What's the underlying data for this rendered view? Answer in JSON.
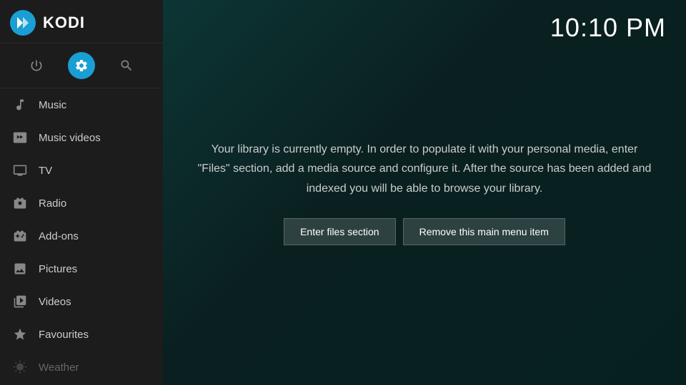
{
  "sidebar": {
    "logo_text": "KODI",
    "top_icons": [
      {
        "name": "power-icon",
        "symbol": "⏻",
        "active": false
      },
      {
        "name": "settings-icon",
        "symbol": "⚙",
        "active": true
      },
      {
        "name": "search-icon",
        "symbol": "🔍",
        "active": false
      }
    ],
    "nav_items": [
      {
        "id": "music",
        "label": "Music",
        "icon_name": "music-icon",
        "dimmed": false
      },
      {
        "id": "music-videos",
        "label": "Music videos",
        "icon_name": "music-video-icon",
        "dimmed": false
      },
      {
        "id": "tv",
        "label": "TV",
        "icon_name": "tv-icon",
        "dimmed": false
      },
      {
        "id": "radio",
        "label": "Radio",
        "icon_name": "radio-icon",
        "dimmed": false
      },
      {
        "id": "add-ons",
        "label": "Add-ons",
        "icon_name": "addons-icon",
        "dimmed": false
      },
      {
        "id": "pictures",
        "label": "Pictures",
        "icon_name": "pictures-icon",
        "dimmed": false
      },
      {
        "id": "videos",
        "label": "Videos",
        "icon_name": "videos-icon",
        "dimmed": false
      },
      {
        "id": "favourites",
        "label": "Favourites",
        "icon_name": "favourites-icon",
        "dimmed": false
      },
      {
        "id": "weather",
        "label": "Weather",
        "icon_name": "weather-icon",
        "dimmed": true
      }
    ]
  },
  "main": {
    "time": "10:10 PM",
    "message": "Your library is currently empty. In order to populate it with your personal media, enter \"Files\" section, add a media source and configure it. After the source has been added and indexed you will be able to browse your library.",
    "buttons": [
      {
        "id": "enter-files",
        "label": "Enter files section"
      },
      {
        "id": "remove-menu-item",
        "label": "Remove this main menu item"
      }
    ]
  }
}
